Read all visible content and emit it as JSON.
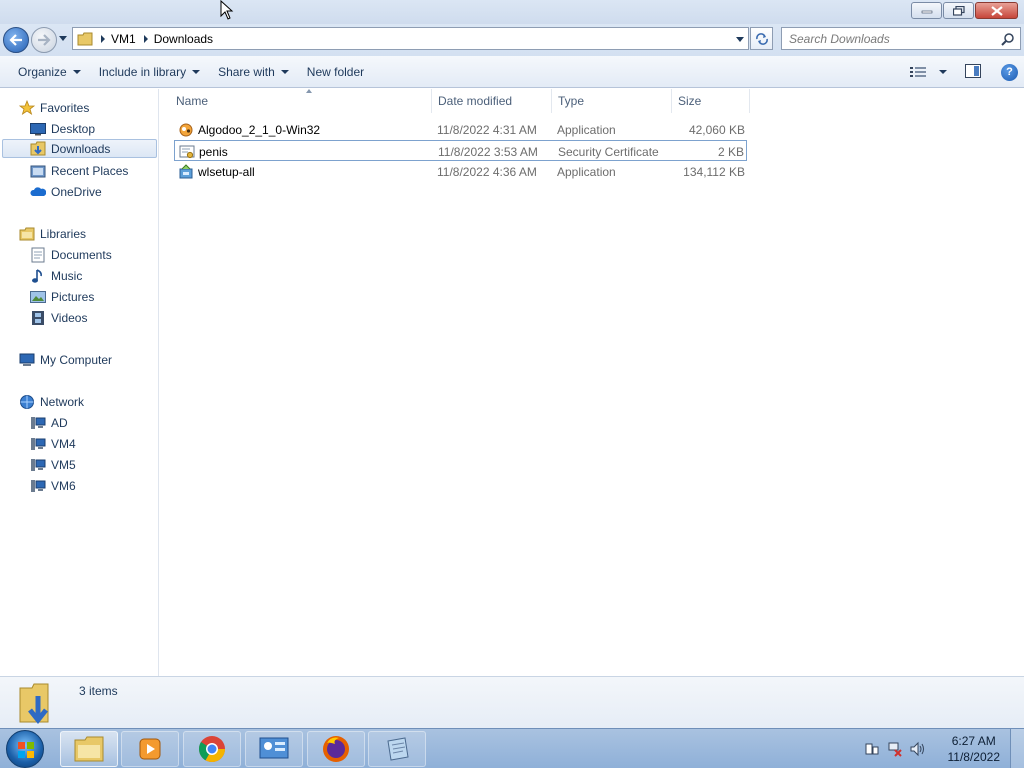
{
  "window": {
    "controls": {
      "minimize": "minimize",
      "maximize": "restore",
      "close": "close"
    }
  },
  "address": {
    "crumbs": [
      "VM1",
      "Downloads"
    ],
    "search_placeholder": "Search Downloads"
  },
  "toolbar": {
    "organize": "Organize",
    "include_in_library": "Include in library",
    "share_with": "Share with",
    "new_folder": "New folder"
  },
  "navpane": {
    "favorites": {
      "label": "Favorites",
      "items": [
        "Desktop",
        "Downloads",
        "Recent Places",
        "OneDrive"
      ]
    },
    "libraries": {
      "label": "Libraries",
      "items": [
        "Documents",
        "Music",
        "Pictures",
        "Videos"
      ]
    },
    "computer": {
      "label": "My Computer"
    },
    "network": {
      "label": "Network",
      "items": [
        "AD",
        "VM4",
        "VM5",
        "VM6"
      ]
    },
    "selected": "Downloads"
  },
  "filelist": {
    "columns": [
      "Name",
      "Date modified",
      "Type",
      "Size"
    ],
    "sort_column": "Name",
    "rows": [
      {
        "name": "Algodoo_2_1_0-Win32",
        "date": "11/8/2022 4:31 AM",
        "type": "Application",
        "size": "42,060 KB",
        "icon": "algodoo-app-icon"
      },
      {
        "name": "penis",
        "date": "11/8/2022 3:53 AM",
        "type": "Security Certificate",
        "size": "2 KB",
        "icon": "certificate-icon"
      },
      {
        "name": "wlsetup-all",
        "date": "11/8/2022 4:36 AM",
        "type": "Application",
        "size": "134,112 KB",
        "icon": "installer-icon"
      }
    ],
    "focused_row": 1
  },
  "details": {
    "count": "3 items"
  },
  "taskbar": {
    "apps": [
      "windows-explorer",
      "media-player",
      "chrome",
      "control-panel",
      "firefox",
      "notepad"
    ],
    "clock_time": "6:27 AM",
    "clock_date": "11/8/2022"
  },
  "colors": {
    "accent": "#1e395b",
    "selection_border": "#7da2ce",
    "taskbar": "#9fbbe0"
  }
}
